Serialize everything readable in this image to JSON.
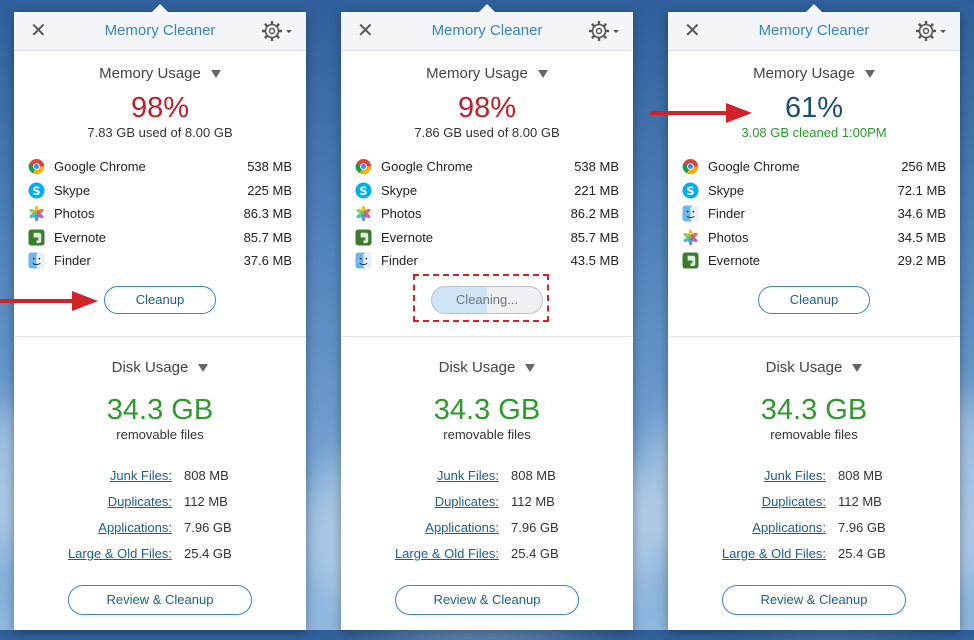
{
  "panels": [
    {
      "title": "Memory Cleaner",
      "memory_header": "Memory Usage",
      "percent": "98%",
      "subtext": "7.83 GB used of 8.00 GB",
      "apps": [
        {
          "name": "Google Chrome",
          "size": "538 MB",
          "icon": "chrome-icon"
        },
        {
          "name": "Skype",
          "size": "225 MB",
          "icon": "skype-icon"
        },
        {
          "name": "Photos",
          "size": "86.3 MB",
          "icon": "photos-icon"
        },
        {
          "name": "Evernote",
          "size": "85.7 MB",
          "icon": "evernote-icon"
        },
        {
          "name": "Finder",
          "size": "37.6 MB",
          "icon": "finder-icon"
        }
      ],
      "button": "Cleanup",
      "disk_header": "Disk Usage",
      "disk_total": "34.3 GB",
      "disk_sub": "removable files",
      "disk_rows": [
        {
          "label": "Junk Files:",
          "value": "808 MB"
        },
        {
          "label": "Duplicates:",
          "value": "112 MB"
        },
        {
          "label": "Applications:",
          "value": "7.96 GB"
        },
        {
          "label": "Large & Old Files:",
          "value": "25.4 GB"
        }
      ],
      "review": "Review & Cleanup"
    },
    {
      "title": "Memory Cleaner",
      "memory_header": "Memory Usage",
      "percent": "98%",
      "subtext": "7.86 GB used of 8.00 GB",
      "apps": [
        {
          "name": "Google Chrome",
          "size": "538 MB",
          "icon": "chrome-icon"
        },
        {
          "name": "Skype",
          "size": "221 MB",
          "icon": "skype-icon"
        },
        {
          "name": "Photos",
          "size": "86.2 MB",
          "icon": "photos-icon"
        },
        {
          "name": "Evernote",
          "size": "85.7 MB",
          "icon": "evernote-icon"
        },
        {
          "name": "Finder",
          "size": "43.5 MB",
          "icon": "finder-icon"
        }
      ],
      "button": "Cleaning...",
      "disk_header": "Disk Usage",
      "disk_total": "34.3 GB",
      "disk_sub": "removable files",
      "disk_rows": [
        {
          "label": "Junk Files:",
          "value": "808 MB"
        },
        {
          "label": "Duplicates:",
          "value": "112 MB"
        },
        {
          "label": "Applications:",
          "value": "7.96 GB"
        },
        {
          "label": "Large & Old Files:",
          "value": "25.4 GB"
        }
      ],
      "review": "Review & Cleanup"
    },
    {
      "title": "Memory Cleaner",
      "memory_header": "Memory Usage",
      "percent": "61%",
      "subtext": "3.08 GB cleaned 1:00PM",
      "apps": [
        {
          "name": "Google Chrome",
          "size": "256 MB",
          "icon": "chrome-icon"
        },
        {
          "name": "Skype",
          "size": "72.1 MB",
          "icon": "skype-icon"
        },
        {
          "name": "Finder",
          "size": "34.6 MB",
          "icon": "finder-icon"
        },
        {
          "name": "Photos",
          "size": "34.5 MB",
          "icon": "photos-icon"
        },
        {
          "name": "Evernote",
          "size": "29.2 MB",
          "icon": "evernote-icon"
        }
      ],
      "button": "Cleanup",
      "disk_header": "Disk Usage",
      "disk_total": "34.3 GB",
      "disk_sub": "removable files",
      "disk_rows": [
        {
          "label": "Junk Files:",
          "value": "808 MB"
        },
        {
          "label": "Duplicates:",
          "value": "112 MB"
        },
        {
          "label": "Applications:",
          "value": "7.96 GB"
        },
        {
          "label": "Large & Old Files:",
          "value": "25.4 GB"
        }
      ],
      "review": "Review & Cleanup"
    }
  ],
  "cleaning_progress": 0.5,
  "colors": {
    "accent": "#3a86c5",
    "alert_red": "#c21e2a",
    "good_green": "#2e9a2e",
    "annotation_red": "#d2232a"
  }
}
